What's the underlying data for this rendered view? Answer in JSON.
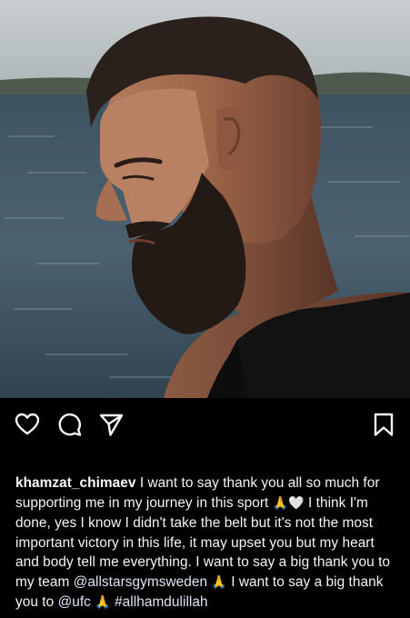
{
  "photo": {
    "alt_subject": "portrait-photo"
  },
  "actions": {
    "like": "heart-icon",
    "comment": "comment-icon",
    "share": "paper-plane-icon",
    "save": "bookmark-icon"
  },
  "caption": {
    "username": "khamzat_chimaev",
    "text_1": "I want to say thank you all so much for supporting me in my journey in this sport",
    "pray_emoji": "🙏",
    "heart_emoji": "🤍",
    "text_2": "I think I'm done, yes I know I didn't take the belt but it's not the most important victory in this life, it may upset you but my heart and body tell me everything. I want to say a big thank you to my team",
    "mention_team": "@allstarsgymsweden",
    "text_3": "I want to say a big thank you to",
    "mention_ufc": "@ufc",
    "hashtag": "#allhamdulillah"
  }
}
